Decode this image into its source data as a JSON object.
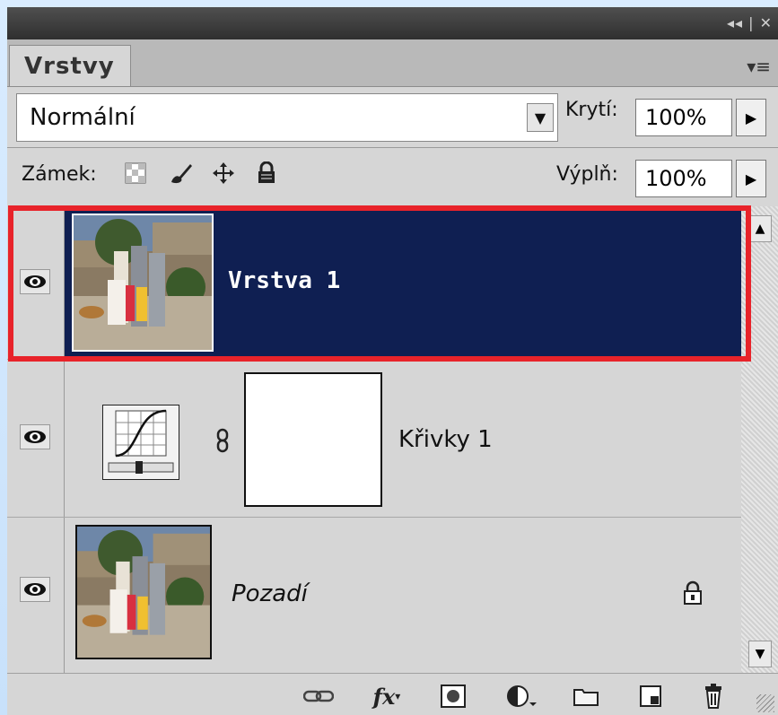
{
  "panel": {
    "titlebar_controls": "◂◂ | ✕",
    "tab_label": "Vrstvy",
    "menu_icon": "panel-menu-icon"
  },
  "options": {
    "blend_mode": "Normální",
    "opacity_label": "Krytí:",
    "opacity_value": "100%",
    "lock_label": "Zámek:",
    "fill_label": "Výplň:",
    "fill_value": "100%"
  },
  "layers": [
    {
      "name": "Vrstva 1",
      "selected": true,
      "visible": true,
      "type": "photo"
    },
    {
      "name": "Křivky 1",
      "selected": false,
      "visible": true,
      "type": "curves-adjustment"
    },
    {
      "name": "Pozadí",
      "selected": false,
      "visible": true,
      "type": "photo",
      "locked": true
    }
  ],
  "footer_icons": [
    "link-layers-icon",
    "fx-icon",
    "add-mask-icon",
    "adjustment-layer-icon",
    "new-group-icon",
    "new-layer-icon",
    "delete-layer-icon"
  ],
  "colors": {
    "selection": "#0f1f52",
    "highlight": "#e8232a",
    "panel_bg": "#d6d6d6"
  }
}
